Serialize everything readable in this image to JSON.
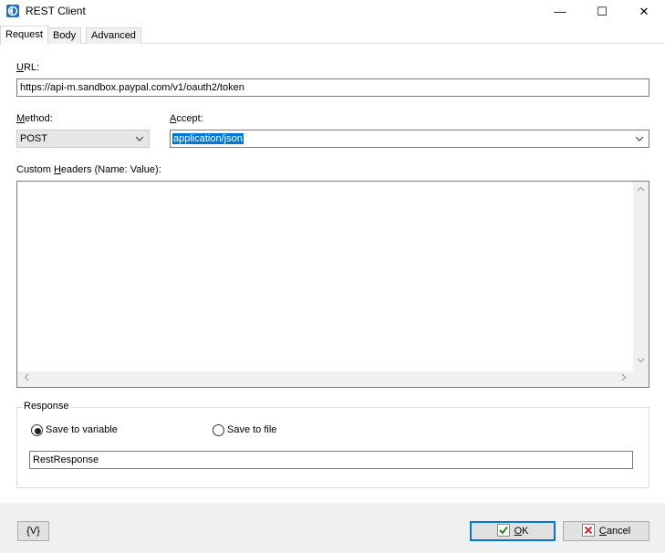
{
  "window": {
    "title": "REST Client",
    "minimize": "—",
    "maximize": "☐",
    "close": "✕"
  },
  "tabs": [
    {
      "label": "Request",
      "active": true
    },
    {
      "label": "Body",
      "active": false
    },
    {
      "label": "Advanced",
      "active": false
    }
  ],
  "request": {
    "url_label_key": "U",
    "url_label_rest": "RL:",
    "url_value": "https://api-m.sandbox.paypal.com/v1/oauth2/token",
    "method_label_key": "M",
    "method_label_rest": "ethod:",
    "method_value": "POST",
    "accept_label_key": "A",
    "accept_label_rest": "ccept:",
    "accept_value": "application/json",
    "headers_label_pre": "Custom ",
    "headers_label_key": "H",
    "headers_label_rest": "eaders (Name: Value):",
    "headers_value": ""
  },
  "response": {
    "legend": "Response",
    "save_to_variable": "Save to variable",
    "save_to_file": "Save to file",
    "selected": "variable",
    "variable_name": "RestResponse"
  },
  "footer": {
    "variables_button": "{V}",
    "ok_key": "O",
    "ok_rest": "K",
    "cancel_key": "C",
    "cancel_rest": "ancel"
  },
  "colors": {
    "accent": "#0078d7",
    "ok_check": "#1a8a1a",
    "cancel_x": "#d32f2f"
  }
}
